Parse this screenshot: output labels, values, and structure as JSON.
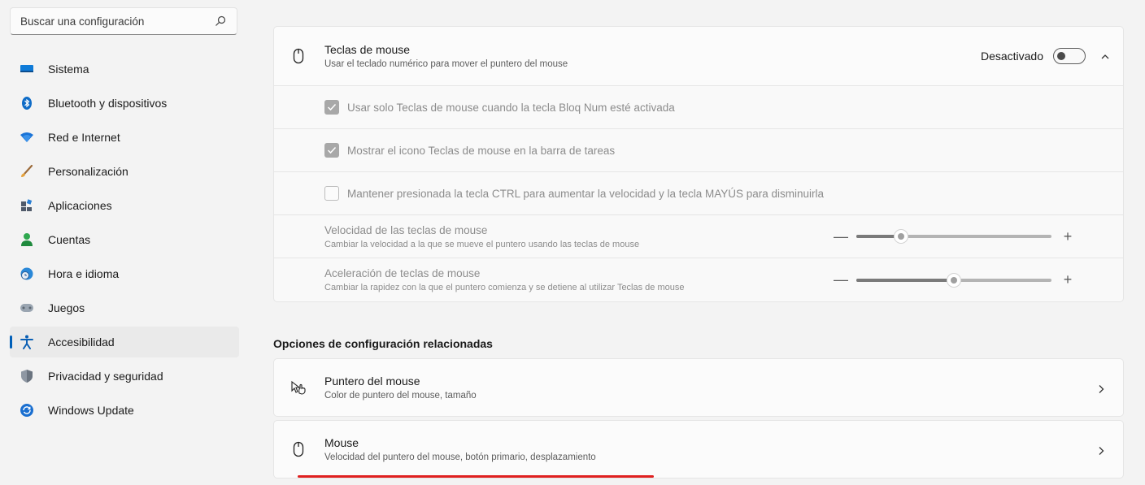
{
  "sidebar": {
    "search_placeholder": "Buscar una configuración",
    "items": [
      {
        "label": "Sistema",
        "icon": "monitor-icon"
      },
      {
        "label": "Bluetooth y dispositivos",
        "icon": "bluetooth-icon"
      },
      {
        "label": "Red e Internet",
        "icon": "wifi-icon"
      },
      {
        "label": "Personalización",
        "icon": "brush-icon"
      },
      {
        "label": "Aplicaciones",
        "icon": "apps-icon"
      },
      {
        "label": "Cuentas",
        "icon": "person-icon"
      },
      {
        "label": "Hora e idioma",
        "icon": "globe-clock-icon"
      },
      {
        "label": "Juegos",
        "icon": "gamepad-icon"
      },
      {
        "label": "Accesibilidad",
        "icon": "accessibility-icon"
      },
      {
        "label": "Privacidad y seguridad",
        "icon": "shield-icon"
      },
      {
        "label": "Windows Update",
        "icon": "update-icon"
      }
    ],
    "active_index": 8
  },
  "mouse_keys": {
    "title": "Teclas de mouse",
    "subtitle": "Usar el teclado numérico para mover el puntero del mouse",
    "toggle_label": "Desactivado",
    "toggle_on": false,
    "options": [
      {
        "label": "Usar solo Teclas de mouse cuando la tecla Bloq Num esté activada",
        "checked": true
      },
      {
        "label": "Mostrar el icono Teclas de mouse en la barra de tareas",
        "checked": true
      },
      {
        "label": "Mantener presionada la tecla CTRL para aumentar la velocidad y la tecla MAYÚS para disminuirla",
        "checked": false
      }
    ],
    "speed": {
      "title": "Velocidad de las teclas de mouse",
      "subtitle": "Cambiar la velocidad a la que se mueve el puntero usando las teclas de mouse",
      "value_fraction": 0.23
    },
    "acceleration": {
      "title": "Aceleración de teclas de mouse",
      "subtitle": "Cambiar la rapidez con la que el puntero comienza y se detiene al utilizar Teclas de mouse",
      "value_fraction": 0.5
    },
    "minus": "—",
    "plus": "+"
  },
  "related": {
    "title": "Opciones de configuración relacionadas",
    "items": [
      {
        "title": "Puntero del mouse",
        "subtitle": "Color de puntero del mouse, tamaño"
      },
      {
        "title": "Mouse",
        "subtitle": "Velocidad del puntero del mouse, botón primario, desplazamiento"
      }
    ]
  },
  "colors": {
    "accent": "#005fb8",
    "highlight_underline": "#e0201f"
  }
}
